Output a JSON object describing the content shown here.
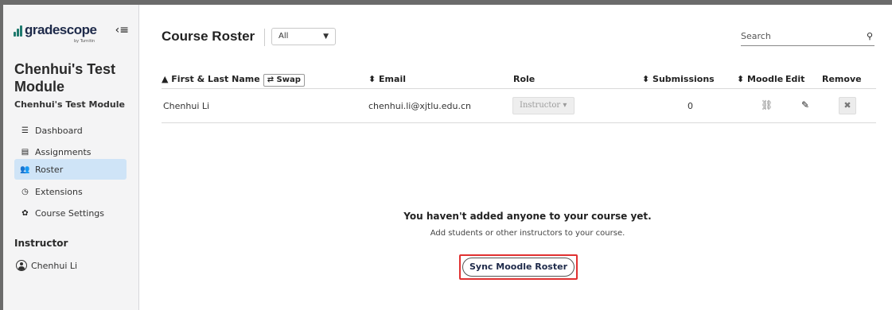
{
  "brand": {
    "name": "gradescope",
    "sub": "by Turnitin"
  },
  "sidebar": {
    "course_title": "Chenhui's Test Module",
    "course_subtitle": "Chenhui's Test Module",
    "items": [
      {
        "label": "Dashboard",
        "icon": "dashboard-icon"
      },
      {
        "label": "Assignments",
        "icon": "assignment-icon"
      },
      {
        "label": "Roster",
        "icon": "users-icon",
        "active": true
      },
      {
        "label": "Extensions",
        "icon": "clock-icon"
      },
      {
        "label": "Course Settings",
        "icon": "gear-icon"
      }
    ],
    "section_label": "Instructor",
    "user": "Chenhui Li"
  },
  "header": {
    "title": "Course Roster",
    "filter_value": "All",
    "search_placeholder": "Search"
  },
  "table": {
    "columns": {
      "name": "▲ First & Last Name",
      "swap": "⇄ Swap",
      "email": "⬍ Email",
      "role": "Role",
      "submissions": "⬍ Submissions",
      "moodle": "⬍ Moodle",
      "edit": "Edit",
      "remove": "Remove"
    },
    "rows": [
      {
        "name": "Chenhui Li",
        "email": "chenhui.li@xjtlu.edu.cn",
        "role": "Instructor ▾",
        "submissions": "0"
      }
    ]
  },
  "empty_state": {
    "title": "You haven't added anyone to your course yet.",
    "subtitle": "Add students or other instructors to your course.",
    "button": "Sync Moodle Roster"
  },
  "colors": {
    "accent": "#1f7a6e",
    "highlight": "#e03131",
    "active_bg": "#cfe4f7"
  }
}
